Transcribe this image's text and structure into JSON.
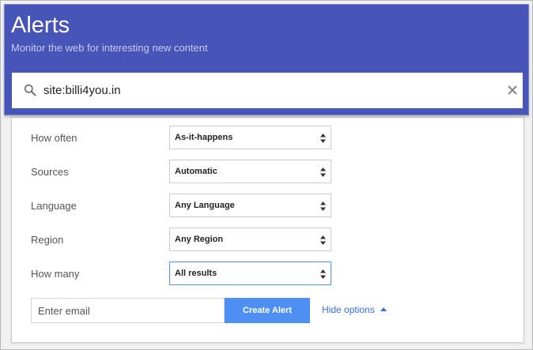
{
  "header": {
    "title": "Alerts",
    "subtitle": "Monitor the web for interesting new content",
    "background_color": "#4755b8"
  },
  "search": {
    "query": "site:billi4you.in",
    "search_icon": "search-icon",
    "clear_icon": "close-icon"
  },
  "options": [
    {
      "label": "How often",
      "value": "As-it-happens"
    },
    {
      "label": "Sources",
      "value": "Automatic"
    },
    {
      "label": "Language",
      "value": "Any Language"
    },
    {
      "label": "Region",
      "value": "Any Region"
    },
    {
      "label": "How many",
      "value": "All results",
      "focused": true
    }
  ],
  "footer": {
    "email_placeholder": "Enter email",
    "create_button_label": "Create Alert",
    "create_button_color": "#4e8ff3",
    "hide_options_label": "Hide options",
    "hide_options_icon": "caret-up-icon",
    "link_color": "#3a6fd6"
  }
}
